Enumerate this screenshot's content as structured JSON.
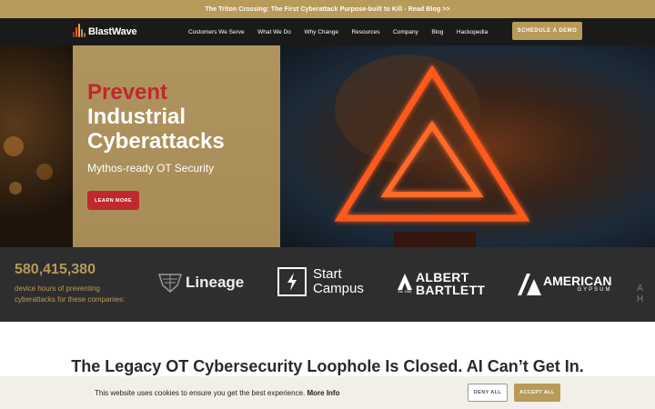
{
  "announcement": {
    "text": "The Triton Crossing: The First Cyberattack Purpose-built to Kill - Read Blog >>"
  },
  "brand": {
    "name": "BlastWave",
    "logo_icon": "blastwave-bars-icon"
  },
  "nav": {
    "items": [
      {
        "label": "Customers We Serve"
      },
      {
        "label": "What We Do"
      },
      {
        "label": "Why Change"
      },
      {
        "label": "Resources"
      },
      {
        "label": "Company"
      },
      {
        "label": "Blog"
      },
      {
        "label": "Hackopedia"
      }
    ],
    "cta_label": "SCHEDULE A DEMO"
  },
  "hero": {
    "title_accent": "Prevent",
    "title_line2": "Industrial",
    "title_line3": "Cyberattacks",
    "subtitle": "Mythos-ready OT Security",
    "button_label": "LEARN MORE",
    "image_icon": "warning-triangle-neon"
  },
  "stats": {
    "number": "580,415,380",
    "label": "device hours of preventing cyberattacks for these companies:"
  },
  "clients": {
    "lineage": "Lineage",
    "start_campus_line1": "Start",
    "start_campus_line2": "Campus",
    "albert_line1": "ALBERT",
    "albert_line2": "BARTLETT",
    "albert_est": "Est. 1966",
    "american_line1": "AMERICAN",
    "american_line2": "GYPSUM",
    "faded_line1": "A",
    "faded_line2": "H"
  },
  "section": {
    "headline": "The Legacy OT Cybersecurity Loophole Is Closed. AI Can’t Get In."
  },
  "cookie": {
    "text": "This website uses cookies to ensure you get the best experience.",
    "more_label": "More Info",
    "deny_label": "DENY ALL",
    "accept_label": "ACCEPT ALL"
  },
  "colors": {
    "gold": "#b89a5a",
    "red": "#c0282d",
    "nav_bg": "#1a1a1a",
    "band_bg": "#2e2e2e",
    "cookie_bg": "#f2efe9"
  }
}
